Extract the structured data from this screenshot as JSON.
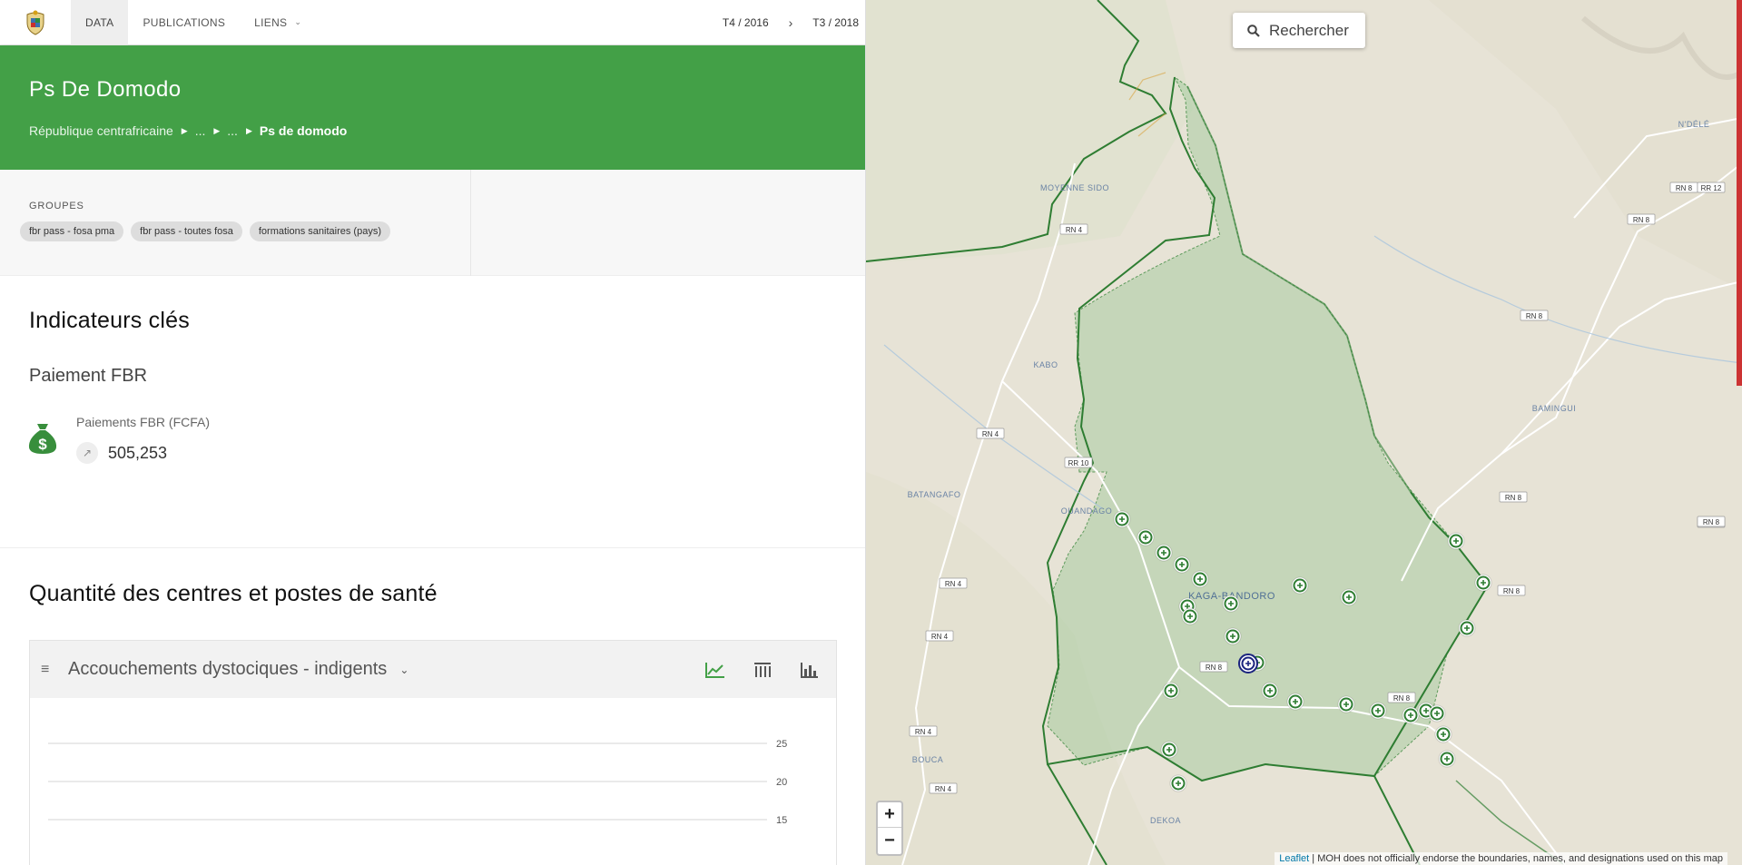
{
  "nav": {
    "items": [
      {
        "label": "DATA",
        "active": true
      },
      {
        "label": "PUBLICATIONS",
        "active": false
      },
      {
        "label": "LIENS",
        "active": false
      }
    ],
    "period_start": "T4 / 2016",
    "period_arrow": "›",
    "period_end": "T3 / 2018"
  },
  "hero": {
    "title": "Ps De Domodo",
    "breadcrumb": [
      "République centrafricaine",
      "...",
      "...",
      "Ps de domodo"
    ],
    "color": "#43a047"
  },
  "groups": {
    "title": "GROUPES",
    "chips": [
      "fbr pass - fosa pma",
      "fbr pass - toutes fosa",
      "formations sanitaires (pays)"
    ]
  },
  "indicators": {
    "title": "Indicateurs clés",
    "section": "Paiement FBR",
    "label": "Paiements FBR (FCFA)",
    "trend_icon": "↗",
    "value": "505,253"
  },
  "centres": {
    "title": "Quantité des centres et postes de santé",
    "chart_selector": "Accouchements dystociques - indigents",
    "tools": [
      "line-chart-icon",
      "column-settings-icon",
      "bar-chart-icon"
    ]
  },
  "chart_data": {
    "type": "line",
    "title": "Accouchements dystociques - indigents",
    "y_ticks": [
      "25",
      "20",
      "15"
    ],
    "ylim": [
      15,
      25
    ],
    "grid": true,
    "series": []
  },
  "map": {
    "search_placeholder": "Rechercher",
    "zoom_in": "+",
    "zoom_out": "−",
    "attribution_link": "Leaflet",
    "attribution_text": " | MOH does not officially endorse the boundaries, names, and designations used on this map",
    "town_labels": [
      "MOYENNE SIDO",
      "KABO",
      "BATANGAFO",
      "OUANDAGO",
      "KAGA-BANDORO",
      "BOUCA",
      "DEKOA",
      "BAMINGUI",
      "N'DÉLÉ"
    ],
    "road_labels": [
      "RN 4",
      "RN 4",
      "RN 4",
      "RN 4",
      "RN 4",
      "RN 4",
      "RR 10",
      "RN 8",
      "RN 8",
      "RN 8",
      "RN 8",
      "RN 8",
      "RN 8",
      "RN 8",
      "RN 8",
      "RN 8",
      "RR 12"
    ],
    "primary_color": "#2e7d32"
  }
}
